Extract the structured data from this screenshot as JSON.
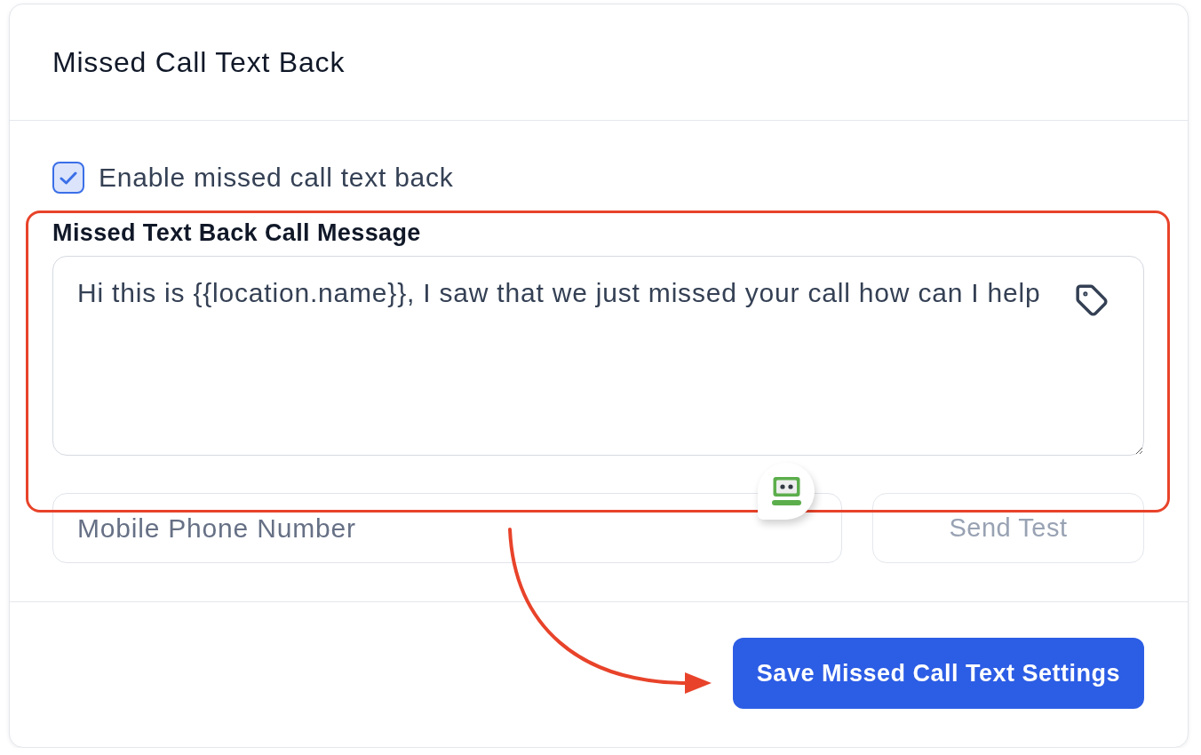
{
  "card": {
    "title": "Missed Call Text Back"
  },
  "enable_option": {
    "label": "Enable missed call text back",
    "checked": true
  },
  "message": {
    "label": "Missed Text Back Call Message",
    "value": "Hi this is {{location.name}}, I saw that we just missed your call how can I help"
  },
  "test": {
    "phone_placeholder": "Mobile Phone Number",
    "button": {
      "label": "Send Test",
      "disabled": true
    }
  },
  "save_button": {
    "label": "Save Missed Call Text Settings"
  }
}
